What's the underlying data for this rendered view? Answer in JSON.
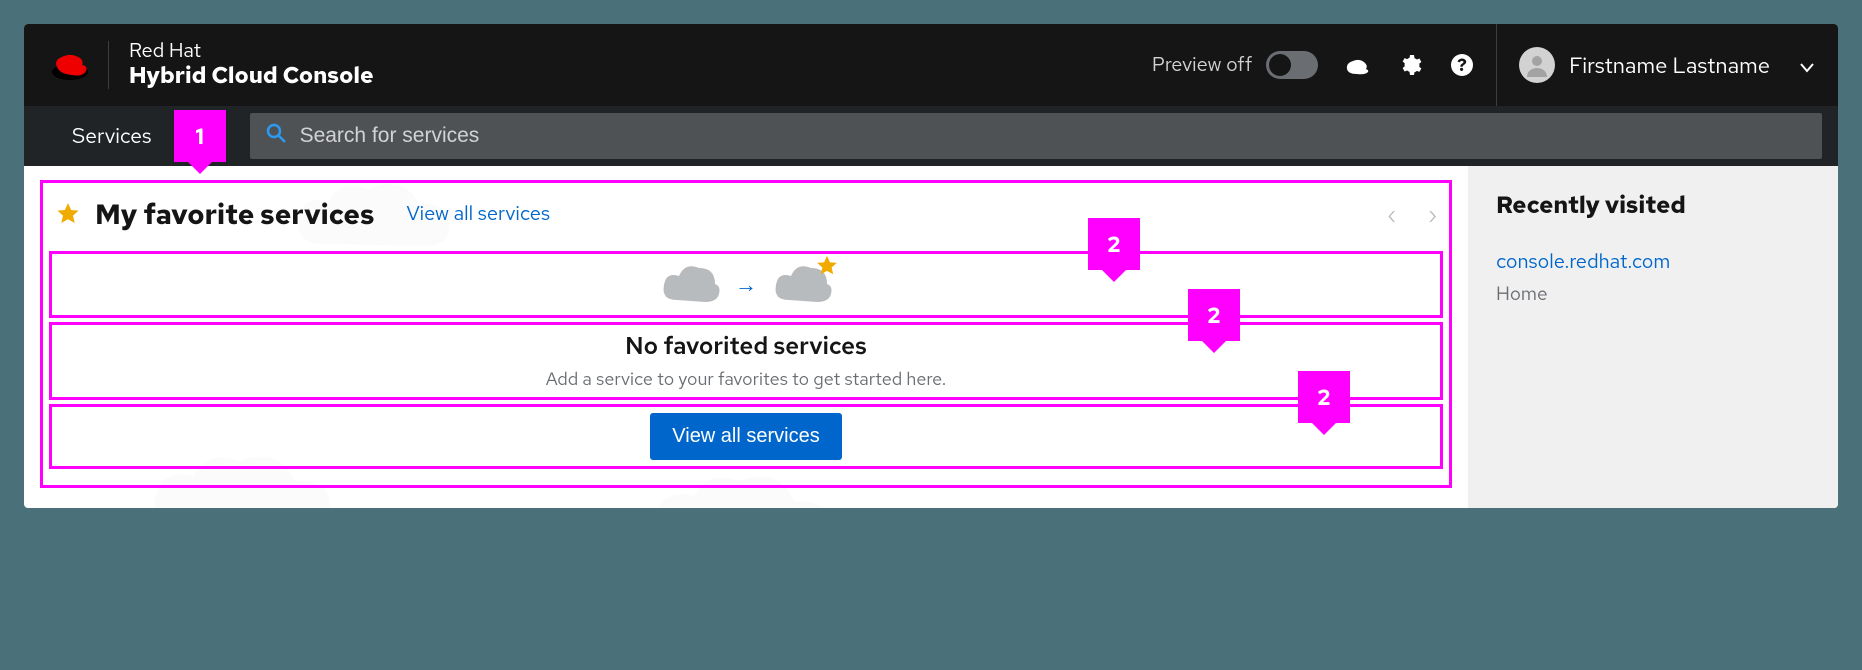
{
  "masthead": {
    "brand_line1": "Red Hat",
    "brand_line2": "Hybrid Cloud Console",
    "preview_label": "Preview off",
    "user_name": "Firstname Lastname"
  },
  "service_bar": {
    "tab_label": "Services",
    "search_placeholder": "Search for services"
  },
  "favorites": {
    "title": "My favorite services",
    "view_all_link": "View all services",
    "empty_title": "No favorited services",
    "empty_subtitle": "Add a service to your favorites to get started here.",
    "empty_button": "View all services"
  },
  "sidebar": {
    "title": "Recently visited",
    "items": [
      {
        "link": "console.redhat.com",
        "sub": "Home"
      }
    ]
  },
  "callouts": {
    "outer": "1",
    "inner_a": "2",
    "inner_b": "2",
    "inner_c": "2"
  }
}
